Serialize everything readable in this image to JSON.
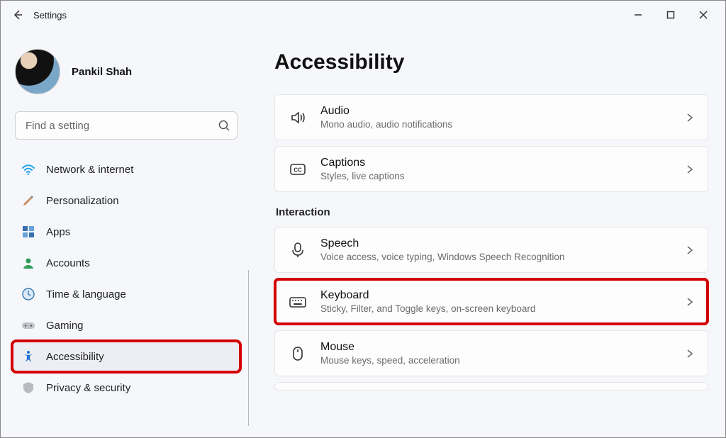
{
  "window": {
    "title": "Settings"
  },
  "profile": {
    "name": "Pankil Shah"
  },
  "search": {
    "placeholder": "Find a setting"
  },
  "nav": {
    "items": [
      {
        "label": "Network & internet"
      },
      {
        "label": "Personalization"
      },
      {
        "label": "Apps"
      },
      {
        "label": "Accounts"
      },
      {
        "label": "Time & language"
      },
      {
        "label": "Gaming"
      },
      {
        "label": "Accessibility"
      },
      {
        "label": "Privacy & security"
      }
    ]
  },
  "page": {
    "title": "Accessibility",
    "section_interaction": "Interaction",
    "cards": {
      "audio": {
        "title": "Audio",
        "sub": "Mono audio, audio notifications"
      },
      "captions": {
        "title": "Captions",
        "sub": "Styles, live captions"
      },
      "speech": {
        "title": "Speech",
        "sub": "Voice access, voice typing, Windows Speech Recognition"
      },
      "keyboard": {
        "title": "Keyboard",
        "sub": "Sticky, Filter, and Toggle keys, on-screen keyboard"
      },
      "mouse": {
        "title": "Mouse",
        "sub": "Mouse keys, speed, acceleration"
      }
    }
  }
}
